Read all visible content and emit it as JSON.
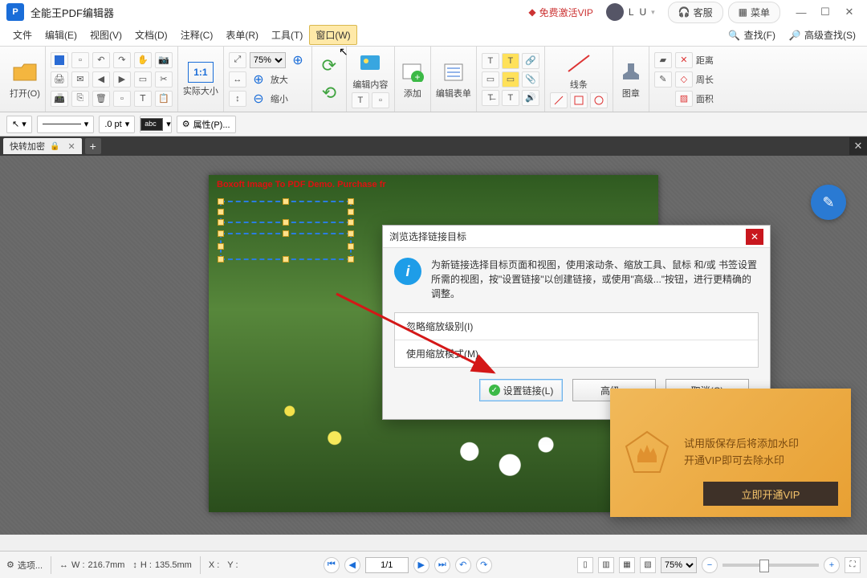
{
  "titlebar": {
    "app_title": "全能王PDF编辑器",
    "vip_link": "免费激活VIP",
    "user_name": "L U",
    "support": "客服",
    "menu": "菜单"
  },
  "menubar": {
    "items": [
      "文件",
      "编辑(E)",
      "视图(V)",
      "文档(D)",
      "注释(C)",
      "表单(R)",
      "工具(T)",
      "窗口(W)"
    ],
    "find": "查找(F)",
    "adv_find": "高级查找(S)"
  },
  "ribbon": {
    "open": "打开(O)",
    "actual_size": "实际大小",
    "zoom_preset": "75%",
    "zoom_in": "放大",
    "zoom_out": "缩小",
    "edit_content": "编辑内容",
    "add": "添加",
    "edit_form": "编辑表单",
    "lines": "线条",
    "stamp": "图章",
    "measure_distance": "距离",
    "measure_perimeter": "周长",
    "measure_area": "面积"
  },
  "toolbar2": {
    "point_size": ".0 pt",
    "swatch_label": "abc",
    "properties": "属性(P)..."
  },
  "tab": {
    "doc_name": "快转加密"
  },
  "page": {
    "demo_text": "Boxoft Image To PDF Demo. Purchase fr"
  },
  "dialog": {
    "title": "浏览选择链接目标",
    "info_text": "为新链接选择目标页面和视图，使用滚动条、缩放工具、鼠标 和/或 书签设置所需的视图，按\"设置链接\"以创建链接，或使用\"高级...\"按钮，进行更精确的调整。",
    "opt_ignore_zoom": "忽略缩放级别(I)",
    "opt_use_zoom": "使用缩放模式(M)",
    "btn_set": "设置链接(L)",
    "btn_adv": "高级...",
    "btn_cancel": "取消(C)"
  },
  "vip": {
    "line1": "试用版保存后将添加水印",
    "line2": "开通VIP即可去除水印",
    "button": "立即开通VIP"
  },
  "statusbar": {
    "options": "选项...",
    "w_label": "W :",
    "w_value": "216.7mm",
    "h_label": "H :",
    "h_value": "135.5mm",
    "x_label": "X :",
    "y_label": "Y :",
    "page": "1/1",
    "zoom": "75%"
  }
}
